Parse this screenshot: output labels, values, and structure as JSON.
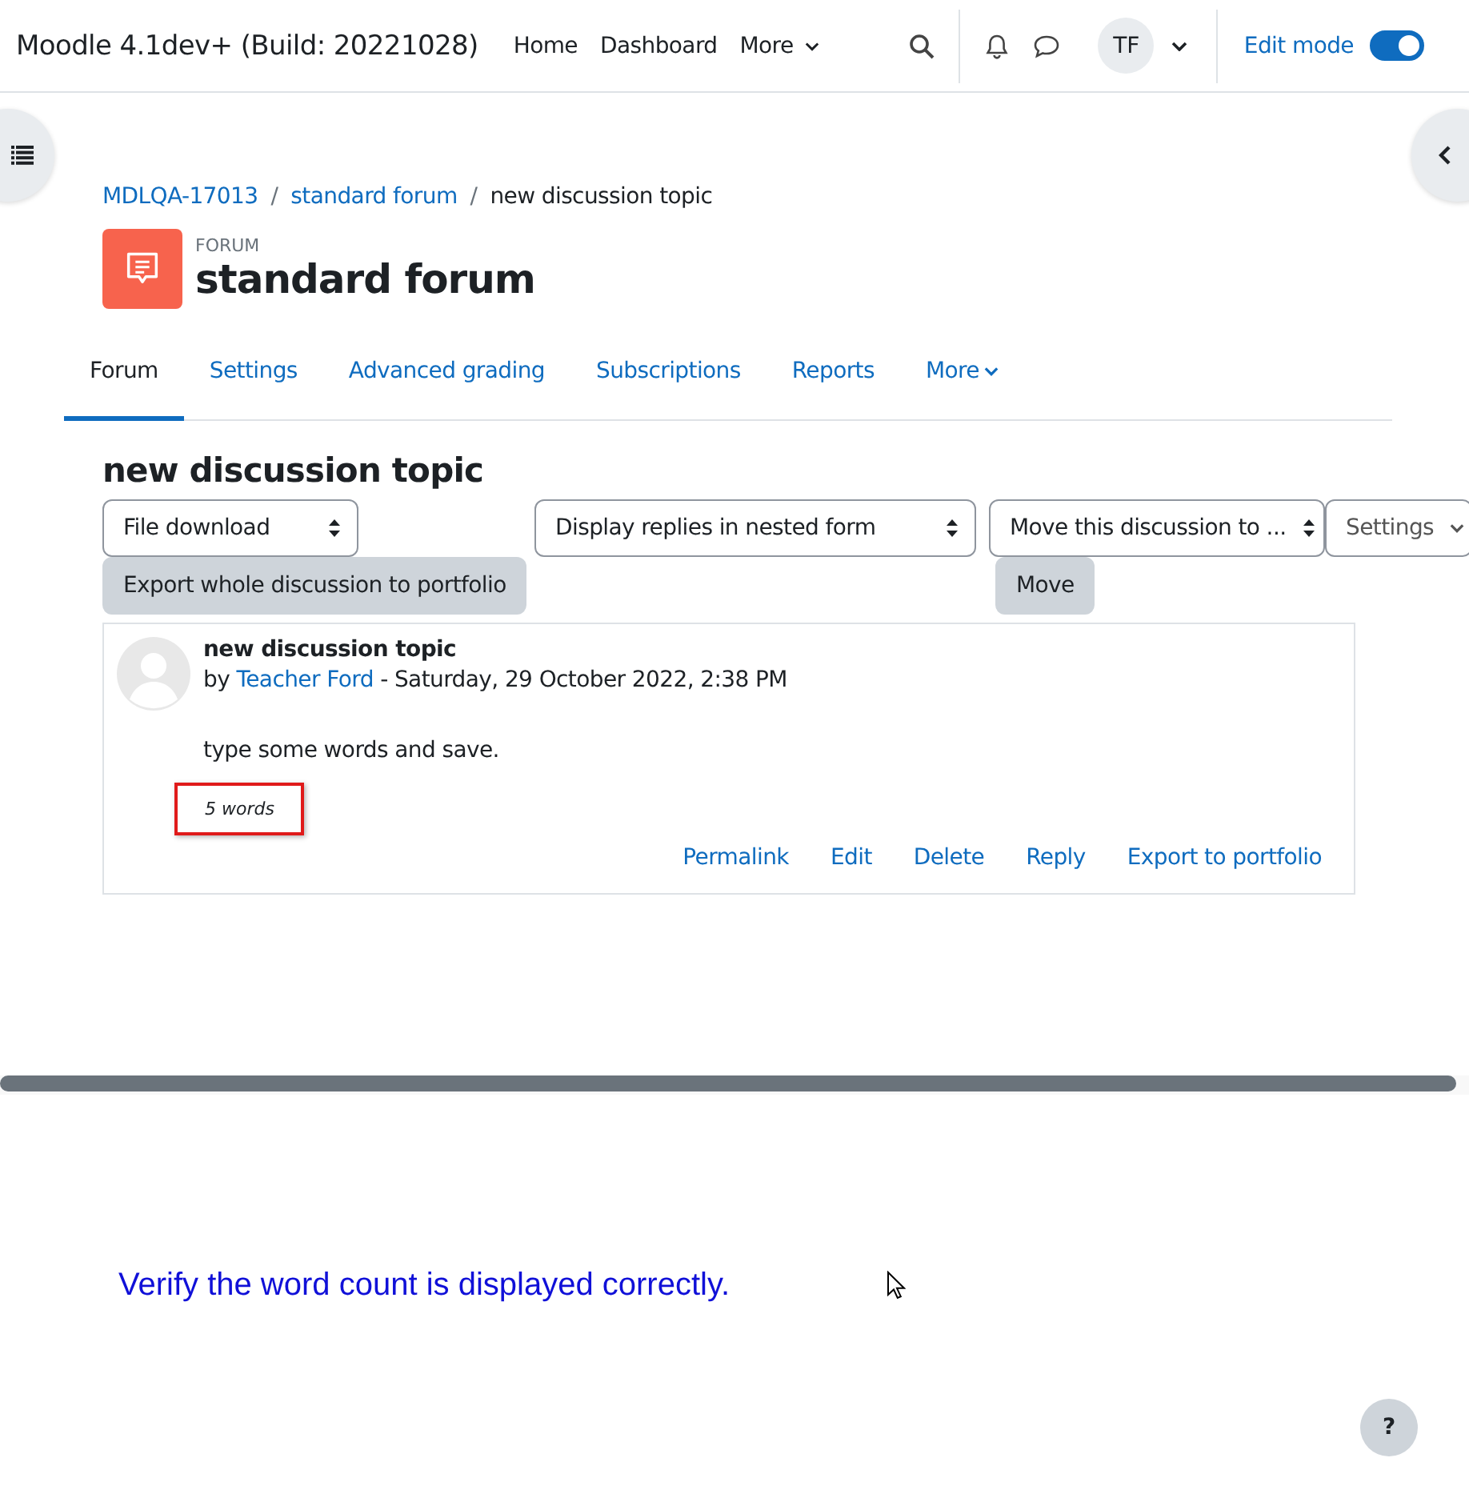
{
  "navbar": {
    "site_name": "Moodle 4.1dev+ (Build: 20221028)",
    "links": [
      {
        "label": "Home",
        "has_menu": false
      },
      {
        "label": "Dashboard",
        "has_menu": false
      },
      {
        "label": "More",
        "has_menu": true
      }
    ],
    "avatar": "TF",
    "edit_mode": {
      "label": "Edit mode",
      "on": true
    }
  },
  "breadcrumb": [
    {
      "label": "MDLQA-17013",
      "link": true
    },
    {
      "separator": "/",
      "label": "standard forum",
      "link": true
    },
    {
      "separator": "/",
      "label": "new discussion topic",
      "link": false
    }
  ],
  "header": {
    "kicker": "FORUM",
    "title": "standard forum"
  },
  "tabs": [
    {
      "label": "Forum",
      "selected": true,
      "has_menu": false
    },
    {
      "label": "Settings",
      "selected": false,
      "has_menu": false
    },
    {
      "label": "Advanced grading",
      "selected": false,
      "has_menu": false
    },
    {
      "label": "Subscriptions",
      "selected": false,
      "has_menu": false
    },
    {
      "label": "Reports",
      "selected": false,
      "has_menu": false
    },
    {
      "label": "More",
      "selected": false,
      "has_menu": true
    }
  ],
  "discussion_title": "new discussion topic",
  "toolbar": [
    {
      "controls": [
        {
          "kind": "select",
          "updown": true,
          "value": "File download"
        },
        {
          "kind": "button",
          "label": "Export whole discussion to portfolio"
        }
      ]
    },
    {
      "controls": [
        {
          "kind": "select",
          "updown": true,
          "value": "Display replies in nested form"
        }
      ]
    },
    {
      "controls": [
        {
          "kind": "select",
          "updown": true,
          "value": "Move this discussion to ..."
        },
        {
          "kind": "button",
          "label": "Move"
        }
      ]
    },
    {
      "controls": [
        {
          "kind": "select",
          "updown": false,
          "value": "Settings"
        }
      ]
    }
  ],
  "post": {
    "subject": "new discussion topic",
    "by": "by",
    "author": "Teacher Ford",
    "date": "- Saturday, 29 October 2022, 2:38 PM",
    "message": "type some words and save.",
    "word_count": {
      "text": "5 words",
      "highlighted": true
    },
    "actions": [
      "Permalink",
      "Edit",
      "Delete",
      "Reply",
      "Export to portfolio"
    ]
  },
  "instruction": "Verify the word count is displayed correctly.",
  "help_button": "?"
}
